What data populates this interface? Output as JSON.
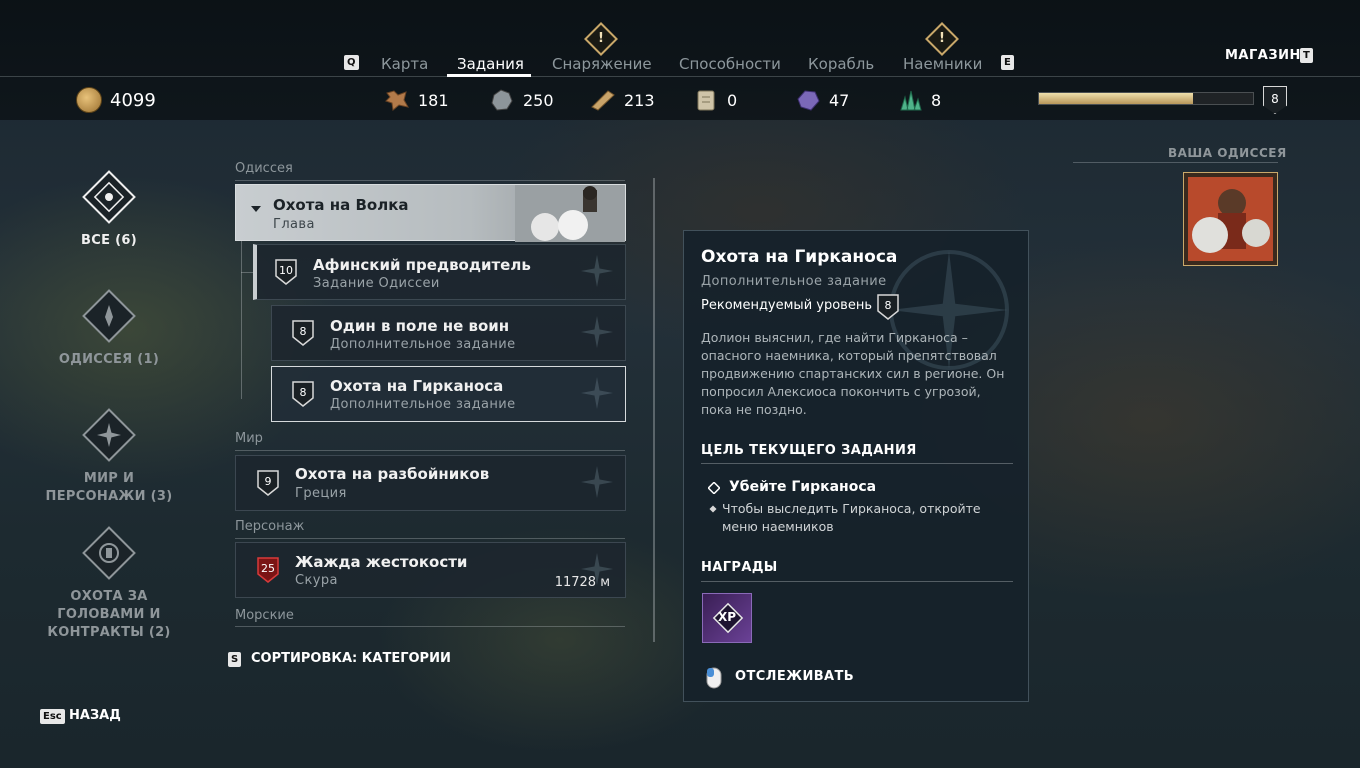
{
  "nav": {
    "left_key": "Q",
    "right_key": "E",
    "tabs": [
      {
        "label": "Карта"
      },
      {
        "label": "Задания"
      },
      {
        "label": "Снаряжение"
      },
      {
        "label": "Способности"
      },
      {
        "label": "Корабль"
      },
      {
        "label": "Наемники"
      }
    ],
    "shop_label": "МАГАЗИН",
    "shop_key": "T"
  },
  "resources": {
    "drachmae": "4099",
    "leather": "181",
    "iron": "250",
    "wood": "213",
    "tablets": "0",
    "obsidian": "47",
    "crystal": "8"
  },
  "player": {
    "level": "8",
    "xp_progress": 0.72
  },
  "categories": [
    {
      "label": "ВСЕ (6)"
    },
    {
      "label": "ОДИССЕЯ (1)"
    },
    {
      "label": "МИР И ПЕРСОНАЖИ (3)"
    },
    {
      "label": "ОХОТА ЗА ГОЛОВАМИ И КОНТРАКТЫ (2)"
    }
  ],
  "list": {
    "sec_odyssey": "Одиссея",
    "chapter_title": "Охота на Волка",
    "chapter_sub": "Глава",
    "q1_level": "10",
    "q1_title": "Афинский предводитель",
    "q1_sub": "Задание Одиссеи",
    "q2_level": "8",
    "q2_title": "Один в поле не воин",
    "q2_sub": "Дополнительное задание",
    "q3_level": "8",
    "q3_title": "Охота на Гирканоса",
    "q3_sub": "Дополнительное задание",
    "sec_world": "Мир",
    "q4_level": "9",
    "q4_title": "Охота на разбойников",
    "q4_sub": "Греция",
    "sec_character": "Персонаж",
    "q5_level": "25",
    "q5_title": "Жажда жестокости",
    "q5_sub": "Скура",
    "q5_distance": "11728 м",
    "sec_naval": "Морские",
    "sort_key": "S",
    "sort_label": "СОРТИРОВКА: КАТЕГОРИИ"
  },
  "detail": {
    "title": "Охота на Гирканоса",
    "subtitle": "Дополнительное задание",
    "rec_level_label": "Рекомендуемый уровень",
    "rec_level": "8",
    "description": "Долион выяснил, где найти Гирканоса – опасного наемника, который препятствовал продвижению спартанских сил в регионе. Он попросил Алексиоса покончить с угрозой, пока не поздно.",
    "objective_header": "ЦЕЛЬ ТЕКУЩЕГО ЗАДАНИЯ",
    "objective": "Убейте Гирканоса",
    "hint": "Чтобы выследить Гирканоса, откройте меню наемников",
    "rewards_header": "НАГРАДЫ",
    "reward_xp": "XP",
    "track_label": "ОТСЛЕЖИВАТЬ"
  },
  "your_odyssey": "ВАША ОДИССЕЯ",
  "back": {
    "key": "Esc",
    "label": "НАЗАД"
  }
}
